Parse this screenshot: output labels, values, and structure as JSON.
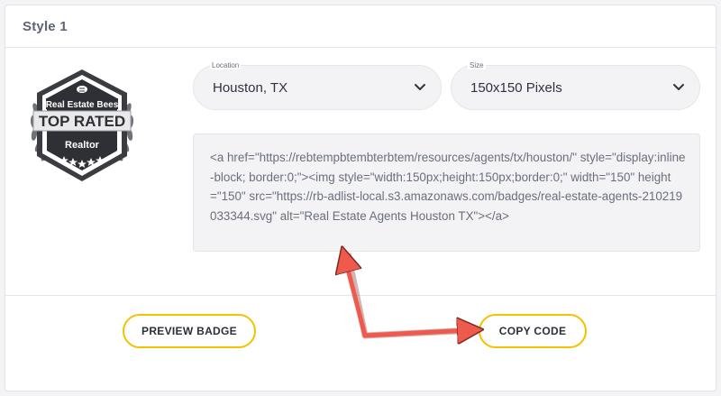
{
  "card": {
    "title": "Style 1"
  },
  "badge": {
    "brand": "Real Estate Bees",
    "headline": "TOP RATED",
    "role": "Realtor"
  },
  "location_select": {
    "label": "Location",
    "value": "Houston, TX"
  },
  "size_select": {
    "label": "Size",
    "value": "150x150 Pixels"
  },
  "code_snippet": "<a href=\"https://rebtempbtembterbtem/resources/agents/tx/houston/\" style=\"display:inline-block; border:0;\"><img style=\"width:150px;height:150px;border:0;\" width=\"150\" height=\"150\" src=\"https://rb-adlist-local.s3.amazonaws.com/badges/real-estate-agents-210219033344.svg\" alt=\"Real Estate Agents Houston TX\"></a>",
  "buttons": {
    "preview": "PREVIEW BADGE",
    "copy": "COPY CODE"
  },
  "colors": {
    "accent": "#f2c200",
    "arrow": "#ef5a4c",
    "badge_dark": "#3a3c42"
  }
}
